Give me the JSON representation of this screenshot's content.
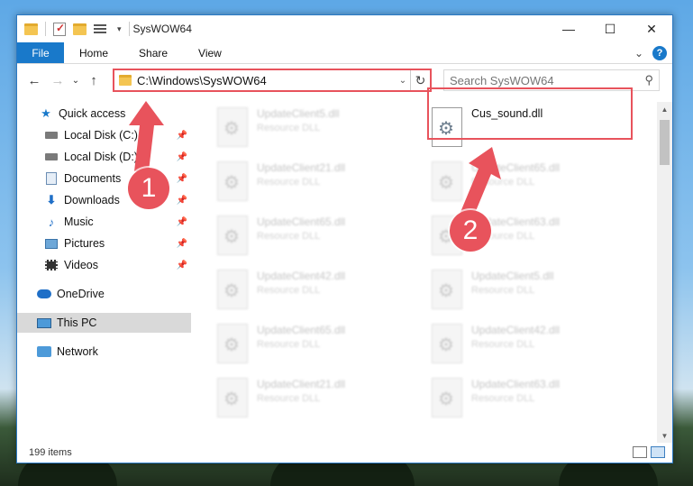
{
  "window": {
    "title": "SysWOW64",
    "controls": {
      "minimize": "—",
      "maximize": "☐",
      "close": "✕"
    }
  },
  "ribbon": {
    "file_tab": "File",
    "tabs": [
      "Home",
      "Share",
      "View"
    ],
    "expand_glyph": "⌄",
    "help_glyph": "?"
  },
  "nav": {
    "back": "←",
    "forward": "→",
    "recent": "⌄",
    "up": "↑"
  },
  "address": {
    "path": "C:\\Windows\\SysWOW64",
    "dropdown": "⌄",
    "refresh": "↻"
  },
  "search": {
    "placeholder": "Search SysWOW64",
    "glyph": "⚲"
  },
  "sidebar": {
    "items": [
      {
        "label": "Quick access",
        "icon": "star-icon",
        "pinned": false
      },
      {
        "label": "Local Disk (C:)",
        "icon": "disk-icon",
        "pinned": true
      },
      {
        "label": "Local Disk (D:)",
        "icon": "disk-icon",
        "pinned": true
      },
      {
        "label": "Documents",
        "icon": "documents-icon",
        "pinned": true
      },
      {
        "label": "Downloads",
        "icon": "downloads-icon",
        "pinned": true
      },
      {
        "label": "Music",
        "icon": "music-icon",
        "pinned": true
      },
      {
        "label": "Pictures",
        "icon": "pictures-icon",
        "pinned": true
      },
      {
        "label": "Videos",
        "icon": "videos-icon",
        "pinned": true
      },
      {
        "label": "OneDrive",
        "icon": "onedrive-icon",
        "pinned": false
      },
      {
        "label": "This PC",
        "icon": "this-pc-icon",
        "pinned": false,
        "selected": true
      },
      {
        "label": "Network",
        "icon": "network-icon",
        "pinned": false
      }
    ],
    "pin_glyph": "📌"
  },
  "files": {
    "left_column": [
      {
        "name": "UpdateClient5.dll",
        "type": "Resource DLL"
      },
      {
        "name": "UpdateClient21.dll",
        "type": "Resource DLL"
      },
      {
        "name": "UpdateClient65.dll",
        "type": "Resource DLL"
      },
      {
        "name": "UpdateClient42.dll",
        "type": "Resource DLL"
      },
      {
        "name": "UpdateClient65.dll",
        "type": "Resource DLL"
      },
      {
        "name": "UpdateClient21.dll",
        "type": "Resource DLL"
      }
    ],
    "right_column": [
      {
        "name": "Cus_sound.dll",
        "type": "",
        "highlighted": true
      },
      {
        "name": "UpdateClient65.dll",
        "type": "Resource DLL"
      },
      {
        "name": "UpdateClient63.dll",
        "type": "Resource DLL"
      },
      {
        "name": "UpdateClient5.dll",
        "type": "Resource DLL"
      },
      {
        "name": "UpdateClient42.dll",
        "type": "Resource DLL"
      },
      {
        "name": "UpdateClient63.dll",
        "type": "Resource DLL"
      }
    ]
  },
  "scrollbar": {
    "up": "▲",
    "down": "▼"
  },
  "status": {
    "item_count": "199 items"
  },
  "annotations": {
    "step1": "1",
    "step2": "2",
    "color": "#e8535c"
  }
}
